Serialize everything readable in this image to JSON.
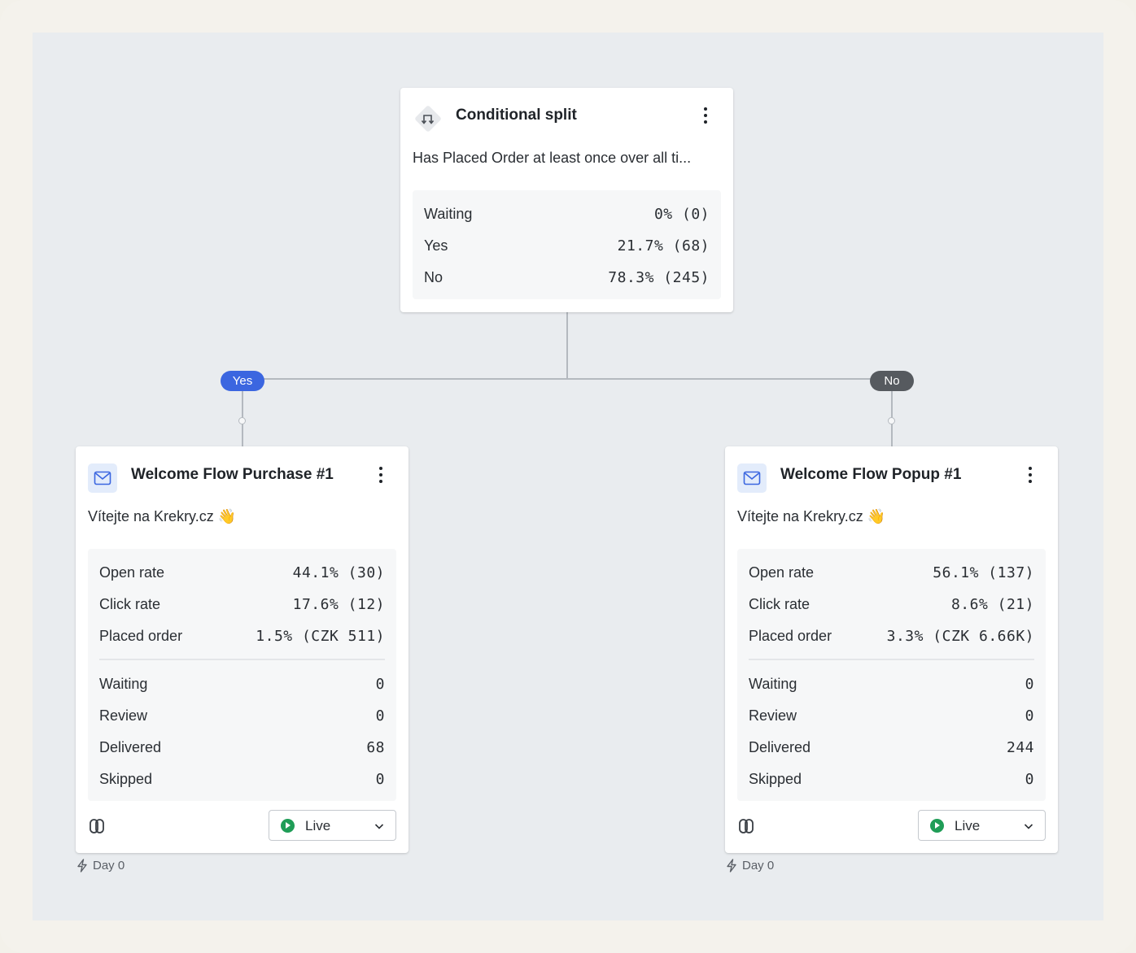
{
  "split": {
    "title": "Conditional split",
    "condition": "Has Placed Order at least once over all ti...",
    "icon": "split-arrows-icon",
    "stats": [
      {
        "label": "Waiting",
        "value": "0% (0)"
      },
      {
        "label": "Yes",
        "value": "21.7% (68)"
      },
      {
        "label": "No",
        "value": "78.3% (245)"
      }
    ]
  },
  "branches": {
    "yes_label": "Yes",
    "no_label": "No",
    "yes_color": "#3b66e0",
    "no_color": "#565a5f"
  },
  "emails": [
    {
      "title": "Welcome Flow Purchase #1",
      "subject": "Vítejte na Krekry.cz 👋",
      "icon": "envelope-icon",
      "metrics": [
        {
          "label": "Open rate",
          "value": "44.1% (30)"
        },
        {
          "label": "Click rate",
          "value": "17.6% (12)"
        },
        {
          "label": "Placed order",
          "value": "1.5% (CZK 511)"
        }
      ],
      "counts": [
        {
          "label": "Waiting",
          "value": "0"
        },
        {
          "label": "Review",
          "value": "0"
        },
        {
          "label": "Delivered",
          "value": "68"
        },
        {
          "label": "Skipped",
          "value": "0"
        }
      ],
      "status": "Live",
      "status_color": "#1f9d57",
      "delay": "Day 0"
    },
    {
      "title": "Welcome Flow Popup #1",
      "subject": "Vítejte na Krekry.cz 👋",
      "icon": "envelope-icon",
      "metrics": [
        {
          "label": "Open rate",
          "value": "56.1% (137)"
        },
        {
          "label": "Click rate",
          "value": "8.6% (21)"
        },
        {
          "label": "Placed order",
          "value": "3.3% (CZK 6.66K)"
        }
      ],
      "counts": [
        {
          "label": "Waiting",
          "value": "0"
        },
        {
          "label": "Review",
          "value": "0"
        },
        {
          "label": "Delivered",
          "value": "244"
        },
        {
          "label": "Skipped",
          "value": "0"
        }
      ],
      "status": "Live",
      "status_color": "#1f9d57",
      "delay": "Day 0"
    }
  ]
}
